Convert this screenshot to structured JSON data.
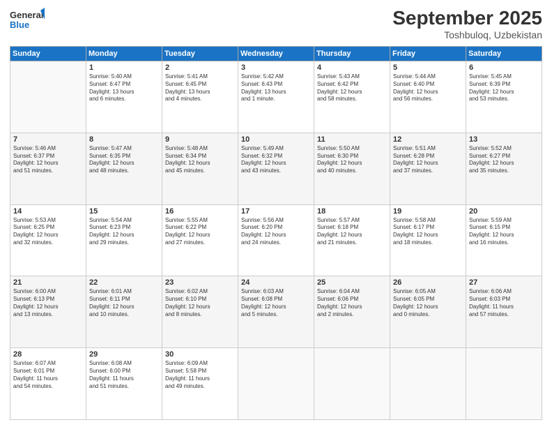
{
  "header": {
    "logo_line1": "General",
    "logo_line2": "Blue",
    "month": "September 2025",
    "location": "Toshbuloq, Uzbekistan"
  },
  "weekdays": [
    "Sunday",
    "Monday",
    "Tuesday",
    "Wednesday",
    "Thursday",
    "Friday",
    "Saturday"
  ],
  "weeks": [
    [
      {
        "day": "",
        "info": ""
      },
      {
        "day": "1",
        "info": "Sunrise: 5:40 AM\nSunset: 6:47 PM\nDaylight: 13 hours\nand 6 minutes."
      },
      {
        "day": "2",
        "info": "Sunrise: 5:41 AM\nSunset: 6:45 PM\nDaylight: 13 hours\nand 4 minutes."
      },
      {
        "day": "3",
        "info": "Sunrise: 5:42 AM\nSunset: 6:43 PM\nDaylight: 13 hours\nand 1 minute."
      },
      {
        "day": "4",
        "info": "Sunrise: 5:43 AM\nSunset: 6:42 PM\nDaylight: 12 hours\nand 58 minutes."
      },
      {
        "day": "5",
        "info": "Sunrise: 5:44 AM\nSunset: 6:40 PM\nDaylight: 12 hours\nand 56 minutes."
      },
      {
        "day": "6",
        "info": "Sunrise: 5:45 AM\nSunset: 6:39 PM\nDaylight: 12 hours\nand 53 minutes."
      }
    ],
    [
      {
        "day": "7",
        "info": "Sunrise: 5:46 AM\nSunset: 6:37 PM\nDaylight: 12 hours\nand 51 minutes."
      },
      {
        "day": "8",
        "info": "Sunrise: 5:47 AM\nSunset: 6:35 PM\nDaylight: 12 hours\nand 48 minutes."
      },
      {
        "day": "9",
        "info": "Sunrise: 5:48 AM\nSunset: 6:34 PM\nDaylight: 12 hours\nand 45 minutes."
      },
      {
        "day": "10",
        "info": "Sunrise: 5:49 AM\nSunset: 6:32 PM\nDaylight: 12 hours\nand 43 minutes."
      },
      {
        "day": "11",
        "info": "Sunrise: 5:50 AM\nSunset: 6:30 PM\nDaylight: 12 hours\nand 40 minutes."
      },
      {
        "day": "12",
        "info": "Sunrise: 5:51 AM\nSunset: 6:28 PM\nDaylight: 12 hours\nand 37 minutes."
      },
      {
        "day": "13",
        "info": "Sunrise: 5:52 AM\nSunset: 6:27 PM\nDaylight: 12 hours\nand 35 minutes."
      }
    ],
    [
      {
        "day": "14",
        "info": "Sunrise: 5:53 AM\nSunset: 6:25 PM\nDaylight: 12 hours\nand 32 minutes."
      },
      {
        "day": "15",
        "info": "Sunrise: 5:54 AM\nSunset: 6:23 PM\nDaylight: 12 hours\nand 29 minutes."
      },
      {
        "day": "16",
        "info": "Sunrise: 5:55 AM\nSunset: 6:22 PM\nDaylight: 12 hours\nand 27 minutes."
      },
      {
        "day": "17",
        "info": "Sunrise: 5:56 AM\nSunset: 6:20 PM\nDaylight: 12 hours\nand 24 minutes."
      },
      {
        "day": "18",
        "info": "Sunrise: 5:57 AM\nSunset: 6:18 PM\nDaylight: 12 hours\nand 21 minutes."
      },
      {
        "day": "19",
        "info": "Sunrise: 5:58 AM\nSunset: 6:17 PM\nDaylight: 12 hours\nand 18 minutes."
      },
      {
        "day": "20",
        "info": "Sunrise: 5:59 AM\nSunset: 6:15 PM\nDaylight: 12 hours\nand 16 minutes."
      }
    ],
    [
      {
        "day": "21",
        "info": "Sunrise: 6:00 AM\nSunset: 6:13 PM\nDaylight: 12 hours\nand 13 minutes."
      },
      {
        "day": "22",
        "info": "Sunrise: 6:01 AM\nSunset: 6:11 PM\nDaylight: 12 hours\nand 10 minutes."
      },
      {
        "day": "23",
        "info": "Sunrise: 6:02 AM\nSunset: 6:10 PM\nDaylight: 12 hours\nand 8 minutes."
      },
      {
        "day": "24",
        "info": "Sunrise: 6:03 AM\nSunset: 6:08 PM\nDaylight: 12 hours\nand 5 minutes."
      },
      {
        "day": "25",
        "info": "Sunrise: 6:04 AM\nSunset: 6:06 PM\nDaylight: 12 hours\nand 2 minutes."
      },
      {
        "day": "26",
        "info": "Sunrise: 6:05 AM\nSunset: 6:05 PM\nDaylight: 12 hours\nand 0 minutes."
      },
      {
        "day": "27",
        "info": "Sunrise: 6:06 AM\nSunset: 6:03 PM\nDaylight: 11 hours\nand 57 minutes."
      }
    ],
    [
      {
        "day": "28",
        "info": "Sunrise: 6:07 AM\nSunset: 6:01 PM\nDaylight: 11 hours\nand 54 minutes."
      },
      {
        "day": "29",
        "info": "Sunrise: 6:08 AM\nSunset: 6:00 PM\nDaylight: 11 hours\nand 51 minutes."
      },
      {
        "day": "30",
        "info": "Sunrise: 6:09 AM\nSunset: 5:58 PM\nDaylight: 11 hours\nand 49 minutes."
      },
      {
        "day": "",
        "info": ""
      },
      {
        "day": "",
        "info": ""
      },
      {
        "day": "",
        "info": ""
      },
      {
        "day": "",
        "info": ""
      }
    ]
  ]
}
